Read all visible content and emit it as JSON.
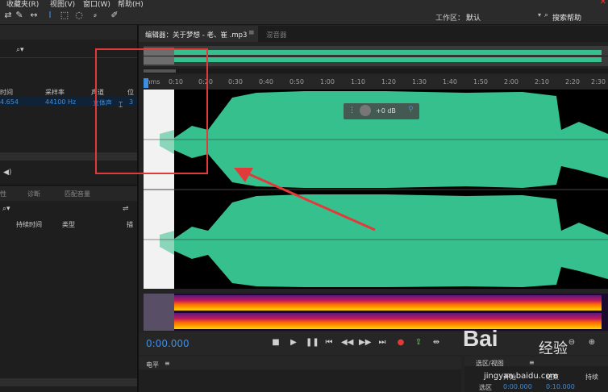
{
  "menu": {
    "items": [
      "收藏夹(R)",
      "视图(V)",
      "窗口(W)",
      "帮助(H)"
    ]
  },
  "toolbar": {
    "workspace_label": "工作区：",
    "workspace_value": "默认",
    "help_search": "搜索帮助"
  },
  "files_panel": {
    "columns": [
      "时间",
      "采样率",
      "声道",
      "位"
    ],
    "row": {
      "duration": "4.654",
      "sample_rate": "44100 Hz",
      "channels": "立体声",
      "bits": "3"
    }
  },
  "markers_panel": {
    "tabs": [
      "性",
      "诊断",
      "匹配音量"
    ],
    "columns": [
      "持续时间",
      "类型",
      "描"
    ]
  },
  "editor": {
    "tab_label": "编辑器：关于梦想 - 老、崔 .mp3",
    "mixer_tab": "混音器",
    "gain_value": "+0 dB"
  },
  "timeline": {
    "start_label": "hms",
    "ticks": [
      "0:10",
      "0:20",
      "0:30",
      "0:40",
      "0:50",
      "1:00",
      "1:10",
      "1:20",
      "1:30",
      "1:40",
      "1:50",
      "2:00",
      "2:10",
      "2:20",
      "2:30"
    ]
  },
  "transport": {
    "current_time": "0:00.000"
  },
  "level_panel": {
    "label": "电平"
  },
  "selection_panel": {
    "title": "选区/视图",
    "columns": [
      "开始",
      "结束",
      "持续"
    ],
    "row_label": "选区",
    "start": "0:00.000",
    "end": "0:10.000"
  },
  "watermark": {
    "logo": "Bai",
    "cn": "经验",
    "url": "jingyan.baidu.com"
  },
  "colors": {
    "waveform": "#36c08e",
    "accent_blue": "#3b8fe0",
    "annotation_red": "#e23a3a"
  }
}
